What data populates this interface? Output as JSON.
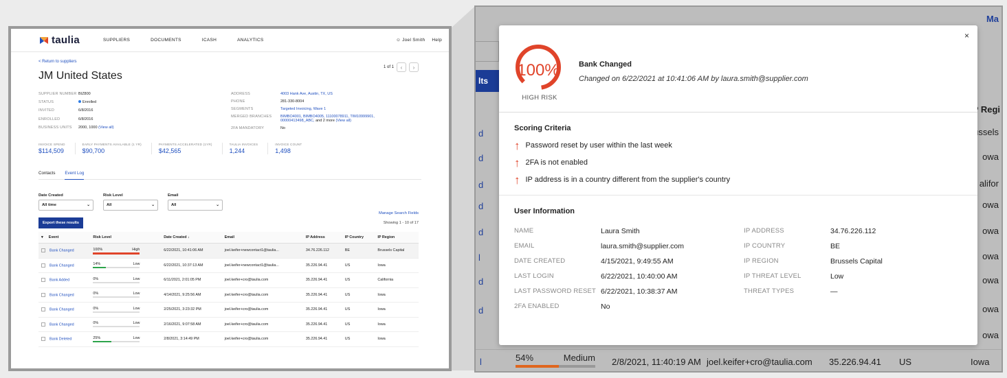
{
  "nav": {
    "brand": "taulia",
    "items": [
      "SUPPLIERS",
      "DOCUMENTS",
      "ICASH",
      "ANALYTICS"
    ],
    "user": "Joel Smith",
    "help": "Help"
  },
  "supplier": {
    "back": "< Return to suppliers",
    "pager": "1 of 1",
    "name": "JM United States",
    "left_fields": [
      {
        "k": "SUPPLIER NUMBER",
        "v": "BIZ800"
      },
      {
        "k": "STATUS",
        "v": "Enrolled"
      },
      {
        "k": "INVITED",
        "v": "6/8/2016"
      },
      {
        "k": "ENROLLED",
        "v": "6/8/2016"
      },
      {
        "k": "BUSINESS UNITS",
        "v": "2000, 1000",
        "link": "(View all)"
      }
    ],
    "right_fields": [
      {
        "k": "ADDRESS",
        "v": "4003 Hank Ave, Austin, TX, US"
      },
      {
        "k": "PHONE",
        "v": "281-330-8004"
      },
      {
        "k": "SEGMENTS",
        "v": "Targeted Invoicing, Wave 1"
      },
      {
        "k": "MERGED BRANCHES",
        "v": "BIMBO4001, BIMBO4005, 11100078911, TIM10999901, 00000413498_ABC,",
        "extra": "and 2 more",
        "link": "(View all)"
      },
      {
        "k": "2FA MANDATORY",
        "v": "No"
      }
    ],
    "stats": [
      {
        "k": "INVOICE SPEND",
        "v": "$114,509"
      },
      {
        "k": "EARLY PAYMENTS AVAILABLE (1 YR)",
        "v": "$90,700"
      },
      {
        "k": "PAYMENTS ACCELERATED (1YR)",
        "v": "$42,565"
      },
      {
        "k": "TAULIA INVOICES",
        "v": "1,244"
      },
      {
        "k": "INVOICE COUNT",
        "v": "1,498"
      }
    ],
    "tabs": [
      "Contacts",
      "Event Log"
    ],
    "manage": "Manage Search Fields"
  },
  "filters": [
    {
      "label": "Date Created",
      "value": "All time"
    },
    {
      "label": "Risk Level",
      "value": "All"
    },
    {
      "label": "Email",
      "value": "All"
    }
  ],
  "export_label": "Export these results",
  "showing": "Showing 1 - 10 of 17",
  "table": {
    "headers": [
      "Event",
      "Risk Level",
      "Date Created ↓",
      "Email",
      "IP Address",
      "IP Country",
      "IP Region"
    ],
    "rows": [
      {
        "event": "Bank Changed",
        "pct": "100%",
        "level": "High",
        "fill": 1.0,
        "color": "#e0442a",
        "date": "6/22/2021, 10:41:06 AM",
        "email": "joel.keifer+newcontact1@taulia...",
        "ip": "34.76.226.112",
        "country": "BE",
        "region": "Brussels Capital"
      },
      {
        "event": "Bank Changed",
        "pct": "14%",
        "level": "Low",
        "fill": 0.14,
        "color": "#2ca44a",
        "date": "6/22/2021, 10:37:13 AM",
        "email": "joel.keifer+newcontact1@taulia...",
        "ip": "35.226.94.41",
        "country": "US",
        "region": "Iowa"
      },
      {
        "event": "Bank Added",
        "pct": "0%",
        "level": "Low",
        "fill": 0.0,
        "color": "#2ca44a",
        "date": "6/11/2021, 2:01:05 PM",
        "email": "joel.keifer+cro@taulia.com",
        "ip": "35.226.94.41",
        "country": "US",
        "region": "California"
      },
      {
        "event": "Bank Changed",
        "pct": "0%",
        "level": "Low",
        "fill": 0.0,
        "color": "#2ca44a",
        "date": "4/14/2021, 9:25:56 AM",
        "email": "joel.keifer+cro@taulia.com",
        "ip": "35.226.94.41",
        "country": "US",
        "region": "Iowa"
      },
      {
        "event": "Bank Changed",
        "pct": "0%",
        "level": "Low",
        "fill": 0.0,
        "color": "#2ca44a",
        "date": "2/25/2021, 3:23:32 PM",
        "email": "joel.keifer+cro@taulia.com",
        "ip": "35.226.94.41",
        "country": "US",
        "region": "Iowa"
      },
      {
        "event": "Bank Changed",
        "pct": "0%",
        "level": "Low",
        "fill": 0.0,
        "color": "#2ca44a",
        "date": "2/16/2021, 9:07:58 AM",
        "email": "joel.keifer+cro@taulia.com",
        "ip": "35.226.94.41",
        "country": "US",
        "region": "Iowa"
      },
      {
        "event": "Bank Deleted",
        "pct": "25%",
        "level": "Low",
        "fill": 0.25,
        "color": "#2ca44a",
        "date": "2/8/2021, 3:14:49 PM",
        "email": "joel.keifer+cro@taulia.com",
        "ip": "35.226.94.41",
        "country": "US",
        "region": "Iowa"
      }
    ]
  },
  "background": {
    "top_right": "Ma",
    "button": "lts",
    "col_header": "P Regi",
    "side_links": [
      "d",
      "d",
      "d",
      "d",
      "d",
      "l",
      "d",
      "d",
      "l"
    ],
    "regions": [
      "russels",
      "owa",
      "alifor",
      "owa",
      "owa",
      "owa",
      "owa",
      "owa",
      "owa"
    ],
    "bottom_row": {
      "pct": "54%",
      "level": "Medium",
      "date": "2/8/2021, 11:40:19 AM",
      "email": "joel.keifer+cro@taulia.com",
      "ip": "35.226.94.41",
      "country": "US",
      "region": "Iowa"
    }
  },
  "modal": {
    "close": "×",
    "gauge_value": "100%",
    "gauge_fill": 1.0,
    "risk_label": "HIGH RISK",
    "title": "Bank Changed",
    "subtitle": "Changed on 6/22/2021 at 10:41:06 AM by laura.smith@supplier.com",
    "criteria_title": "Scoring Criteria",
    "criteria": [
      "Password reset by user within the last week",
      "2FA is not enabled",
      "IP address is in a country different from the supplier's country"
    ],
    "user_title": "User Information",
    "user_info": [
      {
        "k": "NAME",
        "v": "Laura Smith",
        "k2": "IP ADDRESS",
        "v2": "34.76.226.112"
      },
      {
        "k": "EMAIL",
        "v": "laura.smith@supplier.com",
        "k2": "IP COUNTRY",
        "v2": "BE"
      },
      {
        "k": "DATE CREATED",
        "v": "4/15/2021, 9:49:55 AM",
        "k2": "IP REGION",
        "v2": "Brussels Capital"
      },
      {
        "k": "LAST LOGIN",
        "v": "6/22/2021, 10:40:00 AM",
        "k2": "IP THREAT LEVEL",
        "v2": "Low"
      },
      {
        "k": "LAST PASSWORD RESET",
        "v": "6/22/2021, 10:38:37 AM",
        "k2": "THREAT TYPES",
        "v2": "—"
      },
      {
        "k": "2FA ENABLED",
        "v": "No",
        "k2": "",
        "v2": ""
      }
    ],
    "accent": "#e0442a"
  }
}
